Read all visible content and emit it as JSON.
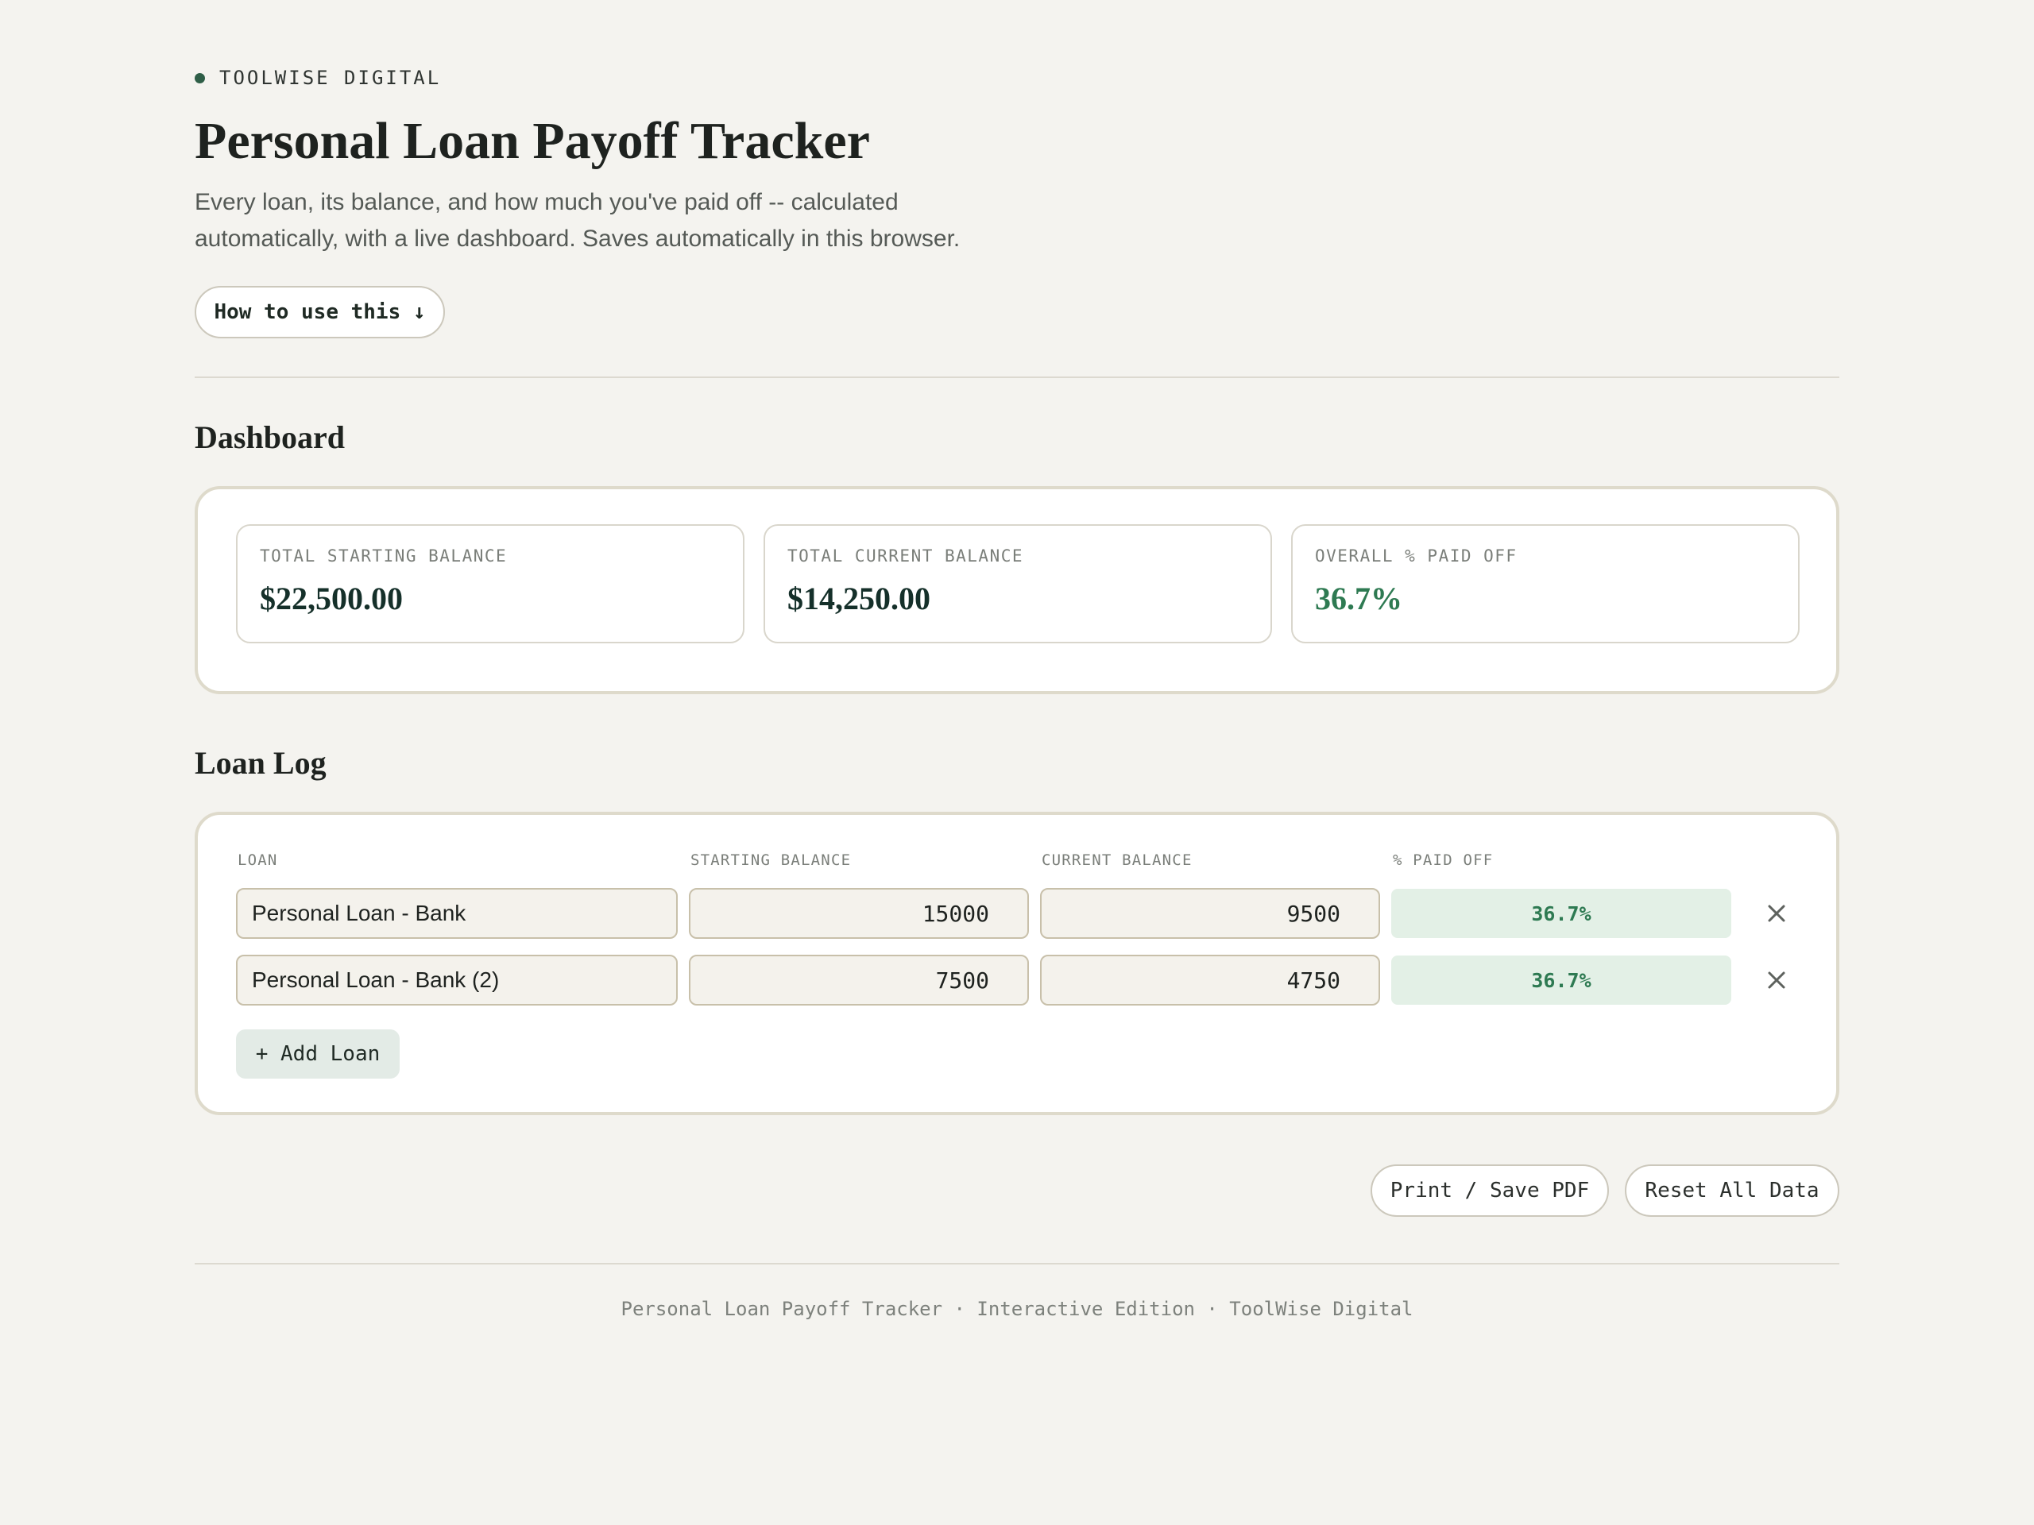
{
  "brand": {
    "name": "TOOLWISE DIGITAL"
  },
  "header": {
    "title": "Personal Loan Payoff Tracker",
    "subtitle": "Every loan, its balance, and how much you've paid off -- calculated automatically, with a live dashboard. Saves automatically in this browser.",
    "how_to_label": "How to use this ↓"
  },
  "dashboard": {
    "title": "Dashboard",
    "stats": [
      {
        "label": "TOTAL STARTING BALANCE",
        "value": "$22,500.00"
      },
      {
        "label": "TOTAL CURRENT BALANCE",
        "value": "$14,250.00"
      },
      {
        "label": "OVERALL % PAID OFF",
        "value": "36.7%"
      }
    ]
  },
  "loan_log": {
    "title": "Loan Log",
    "columns": [
      "LOAN",
      "STARTING BALANCE",
      "CURRENT BALANCE",
      "% PAID OFF"
    ],
    "rows": [
      {
        "name": "Personal Loan - Bank",
        "starting": "15000",
        "current": "9500",
        "paid_pct": "36.7%"
      },
      {
        "name": "Personal Loan - Bank (2)",
        "starting": "7500",
        "current": "4750",
        "paid_pct": "36.7%"
      }
    ],
    "remove_symbol": "×",
    "add_label": "+ Add Loan"
  },
  "actions": {
    "print_label": "Print / Save PDF",
    "reset_label": "Reset All Data"
  },
  "footer": {
    "text": "Personal Loan Payoff Tracker · Interactive Edition · ToolWise Digital"
  },
  "colors": {
    "background": "#f4f3ef",
    "accent_green": "#2e7a52",
    "brand_dot": "#2e5e47",
    "paid_badge_bg": "#e3f0e6"
  },
  "icons": {
    "brand": "dot-icon",
    "remove": "close-icon"
  }
}
